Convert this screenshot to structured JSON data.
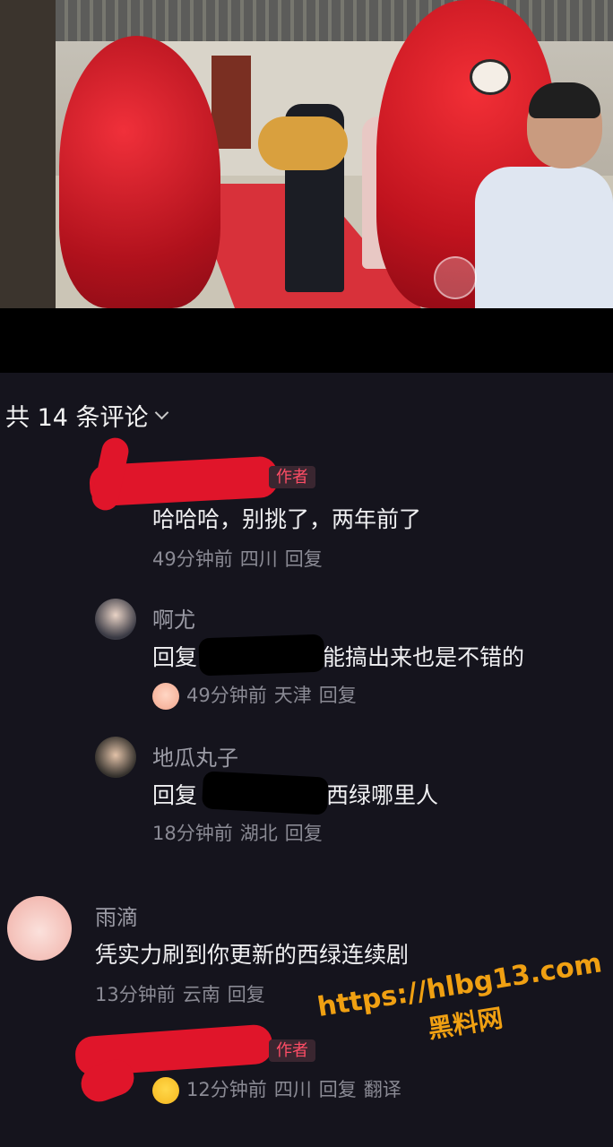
{
  "comments_header": {
    "title": "共 14 条评论"
  },
  "comments": [
    {
      "author_badge": "作者",
      "text": "哈哈哈，别挑了，两年前了",
      "meta": {
        "time": "49分钟前",
        "location": "四川",
        "reply": "回复"
      }
    },
    {
      "name": "啊尤",
      "text_prefix": "回复",
      "text_suffix": "能搞出来也是不错的",
      "meta": {
        "time": "49分钟前",
        "location": "天津",
        "reply": "回复"
      }
    },
    {
      "name": "地瓜丸子",
      "text_prefix": "回复",
      "text_suffix": "西绿哪里人",
      "meta": {
        "time": "18分钟前",
        "location": "湖北",
        "reply": "回复"
      }
    },
    {
      "name": "雨滴",
      "text": "凭实力刷到你更新的西绿连续剧",
      "meta": {
        "time": "13分钟前",
        "location": "云南",
        "reply": "回复"
      }
    },
    {
      "author_badge": "作者",
      "meta": {
        "time": "12分钟前",
        "location": "四川",
        "reply": "回复",
        "translate": "翻译"
      }
    }
  ],
  "watermark": {
    "url": "https://hlbg13.com",
    "label": "黑料网"
  },
  "colors": {
    "background": "#15141d",
    "author_badge": "#ff4d66",
    "watermark": "#f0a012"
  }
}
